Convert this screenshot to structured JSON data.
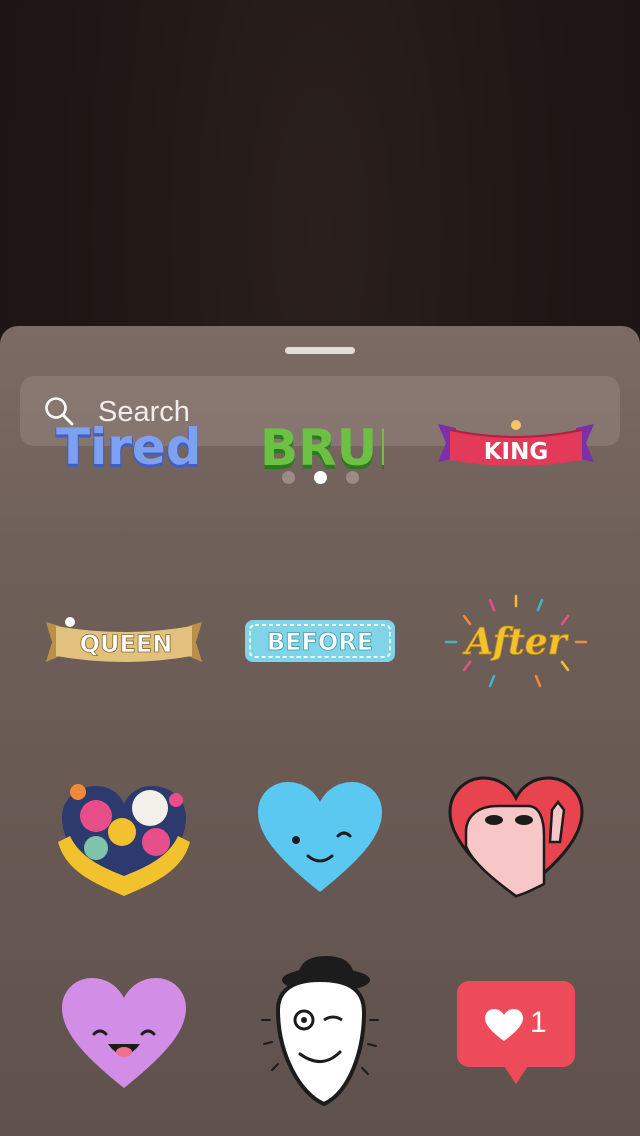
{
  "search": {
    "placeholder": "Search",
    "icon": "search-icon"
  },
  "pager": {
    "count": 3,
    "active_index": 1
  },
  "stickers": {
    "tired": "Tired",
    "bruh": "BRUH",
    "king": "KING",
    "queen": "QUEEN",
    "before": "BEFORE",
    "after": "After",
    "like_count": "1"
  },
  "colors": {
    "sheet": "#6f5f59",
    "tired": "#5b7fe0",
    "bruh": "#5fae3a",
    "king_ribbon": "#e23a58",
    "queen_ribbon": "#d9b46e",
    "before_badge": "#7fd4e8",
    "after_text": "#f2c22e",
    "heart_blue": "#5bc8f2",
    "heart_red": "#e8444f",
    "heart_purple": "#d28ee6",
    "like_badge": "#ee4b5a"
  }
}
